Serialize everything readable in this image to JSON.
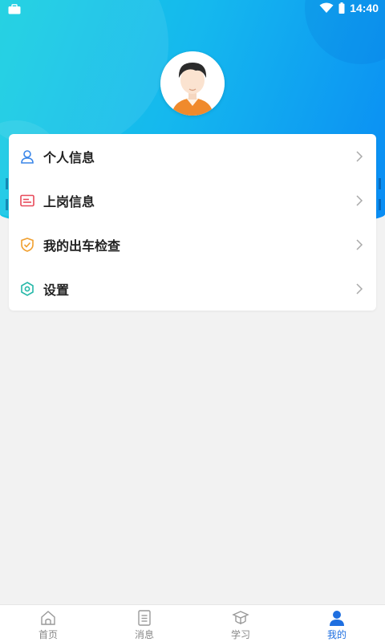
{
  "status_bar": {
    "time": "14:40"
  },
  "colors": {
    "header_from": "#14cfe0",
    "header_to": "#0a8cf4",
    "active_tab": "#1f6fe0"
  },
  "profile": {
    "avatar_icon": "user-avatar"
  },
  "menu": {
    "items": [
      {
        "label": "个人信息",
        "icon": "person-icon",
        "icon_color": "#3a86e8"
      },
      {
        "label": "上岗信息",
        "icon": "card-icon",
        "icon_color": "#e84a5a"
      },
      {
        "label": "我的出车检查",
        "icon": "shield-check-icon",
        "icon_color": "#f0a030"
      },
      {
        "label": "设置",
        "icon": "hexagon-settings-icon",
        "icon_color": "#26b8a8"
      }
    ]
  },
  "tabbar": {
    "tabs": [
      {
        "label": "首页",
        "icon": "home-icon"
      },
      {
        "label": "消息",
        "icon": "document-icon"
      },
      {
        "label": "学习",
        "icon": "graduation-cap-icon"
      },
      {
        "label": "我的",
        "icon": "user-icon",
        "active": true
      }
    ]
  }
}
